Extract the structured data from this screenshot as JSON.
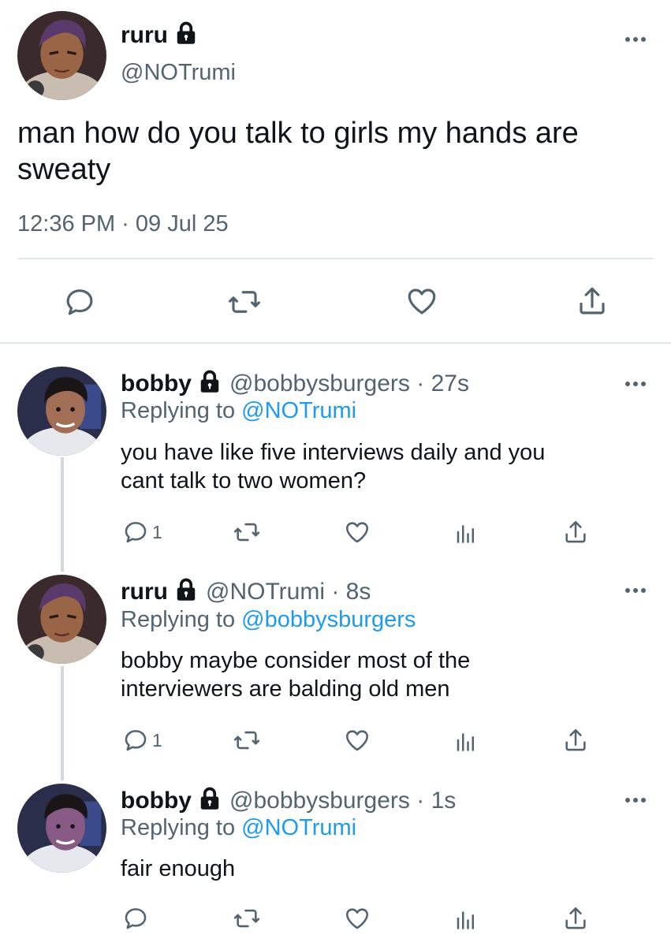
{
  "main_tweet": {
    "name": "ruru",
    "handle": "@NOTrumi",
    "text_line1": "man how do you talk to girls my hands are",
    "text_line2": "sweaty",
    "timestamp": "12:36 PM · 09 Jul 25"
  },
  "replies": [
    {
      "name": "bobby",
      "meta": "@bobbysburgers · 27s",
      "replying_label": "Replying to ",
      "replying_to": "@NOTrumi",
      "text_line1": "you have like five interviews daily and you",
      "text_line2": "cant talk to two women?",
      "reply_count": "1"
    },
    {
      "name": "ruru",
      "meta": "@NOTrumi · 8s",
      "replying_label": "Replying to ",
      "replying_to": "@bobbysburgers",
      "text_line1": "bobby maybe consider most of the",
      "text_line2": "interviewers are balding old men",
      "reply_count": "1"
    },
    {
      "name": "bobby",
      "meta": "@bobbysburgers · 1s",
      "replying_label": "Replying to ",
      "replying_to": "@NOTrumi",
      "text_line1": "fair enough",
      "reply_count": ""
    }
  ],
  "colors": {
    "text": "#0f1419",
    "secondary": "#536471",
    "link": "#1d9bf0",
    "divider": "#e1e8ed"
  },
  "icons": [
    "lock-icon",
    "more-icon",
    "reply-icon",
    "retweet-icon",
    "like-icon",
    "views-icon",
    "share-icon"
  ]
}
